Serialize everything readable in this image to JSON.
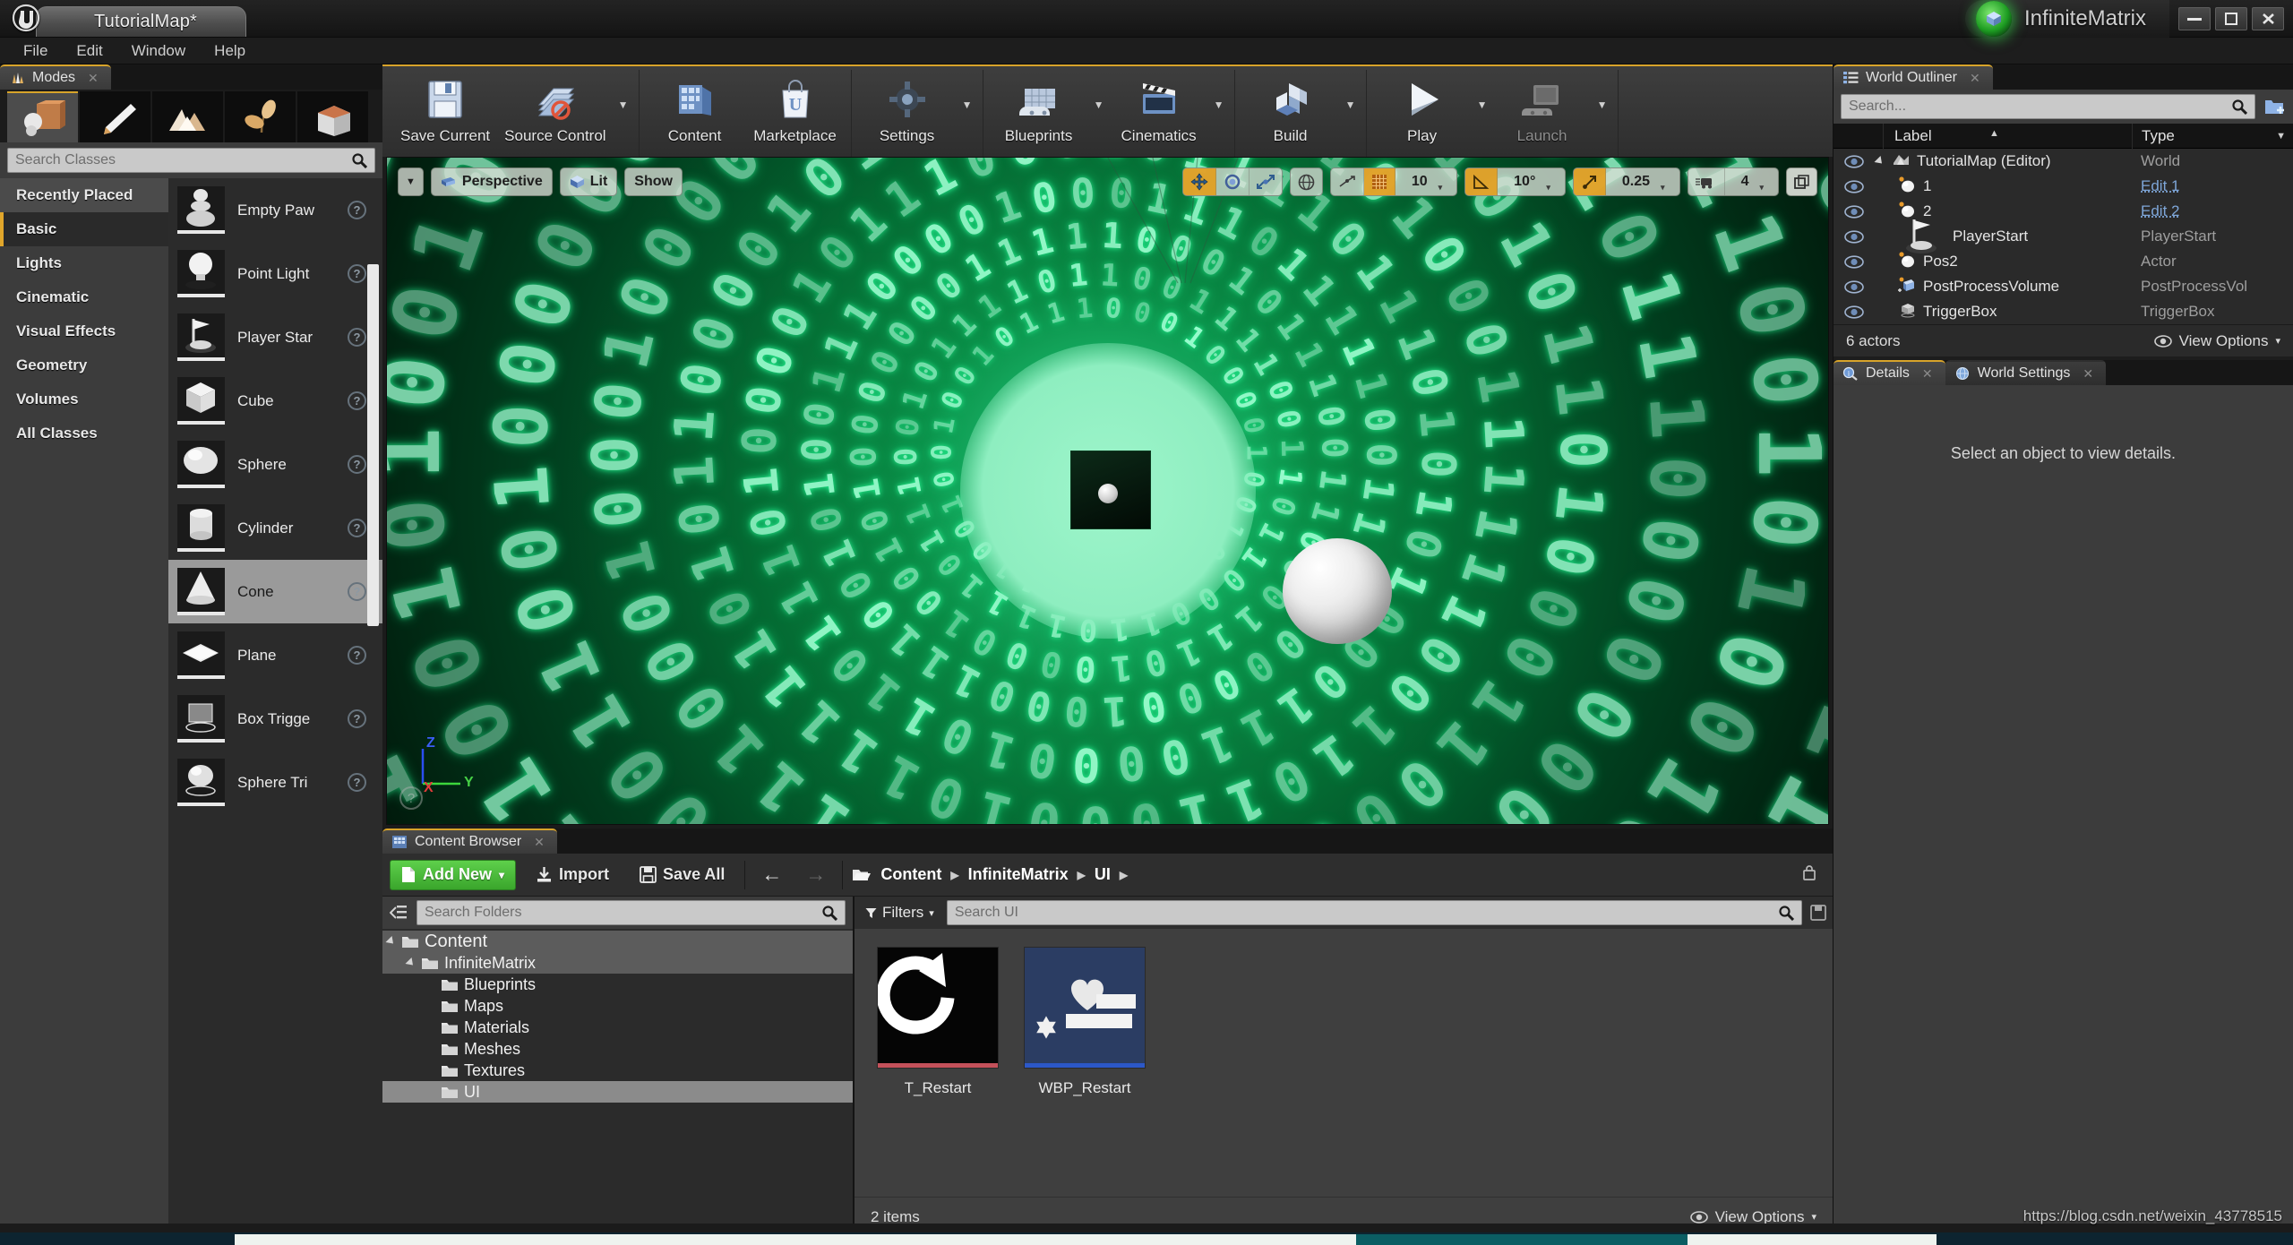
{
  "titlebar": {
    "map_tab": "TutorialMap*",
    "project_name": "InfiniteMatrix",
    "project_icon": "ue-cube-icon",
    "minimize": "—",
    "maximize": "❐",
    "close": "✕"
  },
  "menubar": {
    "items": [
      "File",
      "Edit",
      "Window",
      "Help"
    ]
  },
  "modes_panel": {
    "tab_label": "Modes",
    "tab_icon": "modes-icon",
    "close_icon": "✕",
    "mode_buttons": [
      {
        "name": "place-mode",
        "icon": "cube-sphere-icon",
        "active": true
      },
      {
        "name": "paint-mode",
        "icon": "paintbrush-icon",
        "active": false
      },
      {
        "name": "landscape-mode",
        "icon": "mountain-icon",
        "active": false
      },
      {
        "name": "foliage-mode",
        "icon": "leaf-icon",
        "active": false
      },
      {
        "name": "geometry-editing-mode",
        "icon": "bsp-box-icon",
        "active": false
      }
    ],
    "search_placeholder": "Search Classes",
    "search_value": "",
    "categories": [
      {
        "label": "Recently Placed",
        "selected": false,
        "header": true
      },
      {
        "label": "Basic",
        "selected": true,
        "header": false
      },
      {
        "label": "Lights",
        "selected": false,
        "header": false
      },
      {
        "label": "Cinematic",
        "selected": false,
        "header": false
      },
      {
        "label": "Visual Effects",
        "selected": false,
        "header": false
      },
      {
        "label": "Geometry",
        "selected": false,
        "header": false
      },
      {
        "label": "Volumes",
        "selected": false,
        "header": false
      },
      {
        "label": "All Classes",
        "selected": false,
        "header": false
      }
    ],
    "placeables": [
      {
        "label": "Empty Paw",
        "icon": "pawn-icon",
        "selected": false
      },
      {
        "label": "Point Light",
        "icon": "lightbulb-icon",
        "selected": false
      },
      {
        "label": "Player Star",
        "icon": "player-start-icon",
        "selected": false
      },
      {
        "label": "Cube",
        "icon": "cube-icon",
        "selected": false
      },
      {
        "label": "Sphere",
        "icon": "sphere-icon",
        "selected": false
      },
      {
        "label": "Cylinder",
        "icon": "cylinder-icon",
        "selected": false
      },
      {
        "label": "Cone",
        "icon": "cone-icon",
        "selected": true
      },
      {
        "label": "Plane",
        "icon": "plane-icon",
        "selected": false
      },
      {
        "label": "Box Trigge",
        "icon": "box-trigger-icon",
        "selected": false
      },
      {
        "label": "Sphere Tri",
        "icon": "sphere-trigger-icon",
        "selected": false
      }
    ],
    "help_glyph": "?"
  },
  "main_toolbar": {
    "groups": [
      {
        "buttons": [
          {
            "label": "Save Current",
            "icon": "floppy-disk-icon",
            "dropdown": false,
            "disabled": false
          },
          {
            "label": "Source Control",
            "icon": "source-control-icon",
            "dropdown": true,
            "disabled": false
          }
        ]
      },
      {
        "buttons": [
          {
            "label": "Content",
            "icon": "content-browser-icon",
            "dropdown": false,
            "disabled": false
          },
          {
            "label": "Marketplace",
            "icon": "marketplace-bag-icon",
            "dropdown": false,
            "disabled": false
          }
        ]
      },
      {
        "buttons": [
          {
            "label": "Settings",
            "icon": "gear-icon",
            "dropdown": true,
            "disabled": false
          }
        ]
      },
      {
        "buttons": [
          {
            "label": "Blueprints",
            "icon": "blueprint-icon",
            "dropdown": true,
            "disabled": false
          },
          {
            "label": "Cinematics",
            "icon": "clapperboard-icon",
            "dropdown": true,
            "disabled": false
          }
        ]
      },
      {
        "buttons": [
          {
            "label": "Build",
            "icon": "build-icon",
            "dropdown": true,
            "disabled": false
          }
        ]
      },
      {
        "buttons": [
          {
            "label": "Play",
            "icon": "play-triangle-icon",
            "dropdown": true,
            "disabled": false
          },
          {
            "label": "Launch",
            "icon": "launch-device-icon",
            "dropdown": true,
            "disabled": true
          }
        ]
      }
    ]
  },
  "viewport": {
    "menu_caret": "▼",
    "view_mode": "Perspective",
    "view_mode_icon": "camera-icon",
    "lighting": "Lit",
    "lighting_icon": "lit-cube-icon",
    "show": "Show",
    "transform_tools": [
      {
        "name": "translate-tool",
        "icon": "move-arrows-icon",
        "active": true
      },
      {
        "name": "rotate-tool",
        "icon": "rotate-icon",
        "active": false
      },
      {
        "name": "scale-tool",
        "icon": "scale-icon",
        "active": false
      }
    ],
    "coord_system_icon": "world-globe-icon",
    "surface_snap_icon": "surface-snap-icon",
    "grid_snap_icon": "grid-icon",
    "grid_snap_active": true,
    "grid_snap_value": "10",
    "rotation_snap_icon": "angle-icon",
    "rotation_snap_active": true,
    "rotation_snap_value": "10°",
    "scale_snap_icon": "scale-snap-icon",
    "scale_snap_active": true,
    "scale_snap_value": "0.25",
    "camera_speed_icon": "camera-speed-icon",
    "camera_speed_value": "4",
    "maximize_icon": "maximize-viewport-icon",
    "caret": "▾",
    "axis_labels": {
      "x": "X",
      "y": "Y",
      "z": "Z"
    },
    "help_glyph": "?",
    "scene_description": "Green binary-code tunnel with white sphere"
  },
  "content_browser": {
    "tab_label": "Content Browser",
    "tab_icon": "content-browser-icon",
    "close_icon": "✕",
    "add_new": "Add New",
    "add_new_caret": "▾",
    "add_new_icon": "new-asset-icon",
    "import": "Import",
    "import_icon": "import-icon",
    "save_all": "Save All",
    "save_all_icon": "floppy-disk-icon",
    "back_icon": "←",
    "forward_icon": "→",
    "path_folder_icon": "folder-open-icon",
    "breadcrumb": [
      "Content",
      "InfiniteMatrix",
      "UI"
    ],
    "breadcrumb_sep": "▶",
    "lock_icon": "lock-icon",
    "folder_search_placeholder": "Search Folders",
    "folder_search_value": "",
    "collapse_icon": "collapse-tree-icon",
    "tree": [
      {
        "label": "Content",
        "depth": 0,
        "expander": true,
        "state": "hl"
      },
      {
        "label": "InfiniteMatrix",
        "depth": 1,
        "expander": true,
        "state": "hl"
      },
      {
        "label": "Blueprints",
        "depth": 2,
        "expander": false,
        "state": ""
      },
      {
        "label": "Maps",
        "depth": 2,
        "expander": false,
        "state": ""
      },
      {
        "label": "Materials",
        "depth": 2,
        "expander": false,
        "state": ""
      },
      {
        "label": "Meshes",
        "depth": 2,
        "expander": false,
        "state": ""
      },
      {
        "label": "Textures",
        "depth": 2,
        "expander": false,
        "state": ""
      },
      {
        "label": "UI",
        "depth": 2,
        "expander": false,
        "state": "sel"
      }
    ],
    "filters_label": "Filters",
    "filters_caret": "▾",
    "filters_icon": "funnel-icon",
    "asset_search_placeholder": "Search UI",
    "asset_search_value": "",
    "save_search_icon": "save-search-icon",
    "assets": [
      {
        "name": "T_Restart",
        "icon": "restart-arrow-icon",
        "type_color": "#c4515a",
        "bg": "#050505"
      },
      {
        "name": "WBP_Restart",
        "icon": "widget-blueprint-icon",
        "type_color": "#2c58c8",
        "bg": "#2b3d63"
      }
    ],
    "item_count": "2 items",
    "view_options": "View Options",
    "view_options_caret": "▾",
    "view_options_icon": "eye-icon"
  },
  "world_outliner": {
    "tab_label": "World Outliner",
    "tab_icon": "outliner-list-icon",
    "close_icon": "✕",
    "search_placeholder": "Search...",
    "search_value": "",
    "add_icon": "add-folder-icon",
    "sort_caret": "▲",
    "type_caret": "▼",
    "columns": {
      "label": "Label",
      "type": "Type"
    },
    "rows": [
      {
        "label": "TutorialMap (Editor)",
        "type": "World",
        "icon": "world-icon",
        "indent": 0,
        "link": false,
        "expander": true
      },
      {
        "label": "1",
        "type": "Edit 1",
        "icon": "sphere-actor-icon",
        "indent": 1,
        "link": true,
        "expander": false
      },
      {
        "label": "2",
        "type": "Edit 2",
        "icon": "sphere-actor-icon",
        "indent": 1,
        "link": true,
        "expander": false
      },
      {
        "label": "PlayerStart",
        "type": "PlayerStart",
        "icon": "player-start-icon",
        "indent": 1,
        "link": false,
        "expander": false
      },
      {
        "label": "Pos2",
        "type": "Actor",
        "icon": "sphere-actor-icon",
        "indent": 1,
        "link": false,
        "expander": false
      },
      {
        "label": "PostProcessVolume",
        "type": "PostProcessVol",
        "icon": "post-process-icon",
        "indent": 1,
        "link": false,
        "expander": false
      },
      {
        "label": "TriggerBox",
        "type": "TriggerBox",
        "icon": "trigger-box-icon",
        "indent": 1,
        "link": false,
        "expander": false
      }
    ],
    "actor_count": "6 actors",
    "view_options": "View Options",
    "view_options_caret": "▾",
    "view_options_icon": "eye-icon"
  },
  "details_panel": {
    "tabs": [
      {
        "label": "Details",
        "icon": "details-magnifier-icon",
        "active": true
      },
      {
        "label": "World Settings",
        "icon": "world-settings-globe-icon",
        "active": false
      }
    ],
    "empty_message": "Select an object to view details.",
    "close_icon": "✕"
  },
  "watermark": "https://blog.csdn.net/weixin_43778515",
  "colors": {
    "accent_orange": "#d8a42a",
    "add_new_green": "#4bc13a",
    "matrix_green": "#2bff9a",
    "link_blue": "#7ea6d8"
  }
}
